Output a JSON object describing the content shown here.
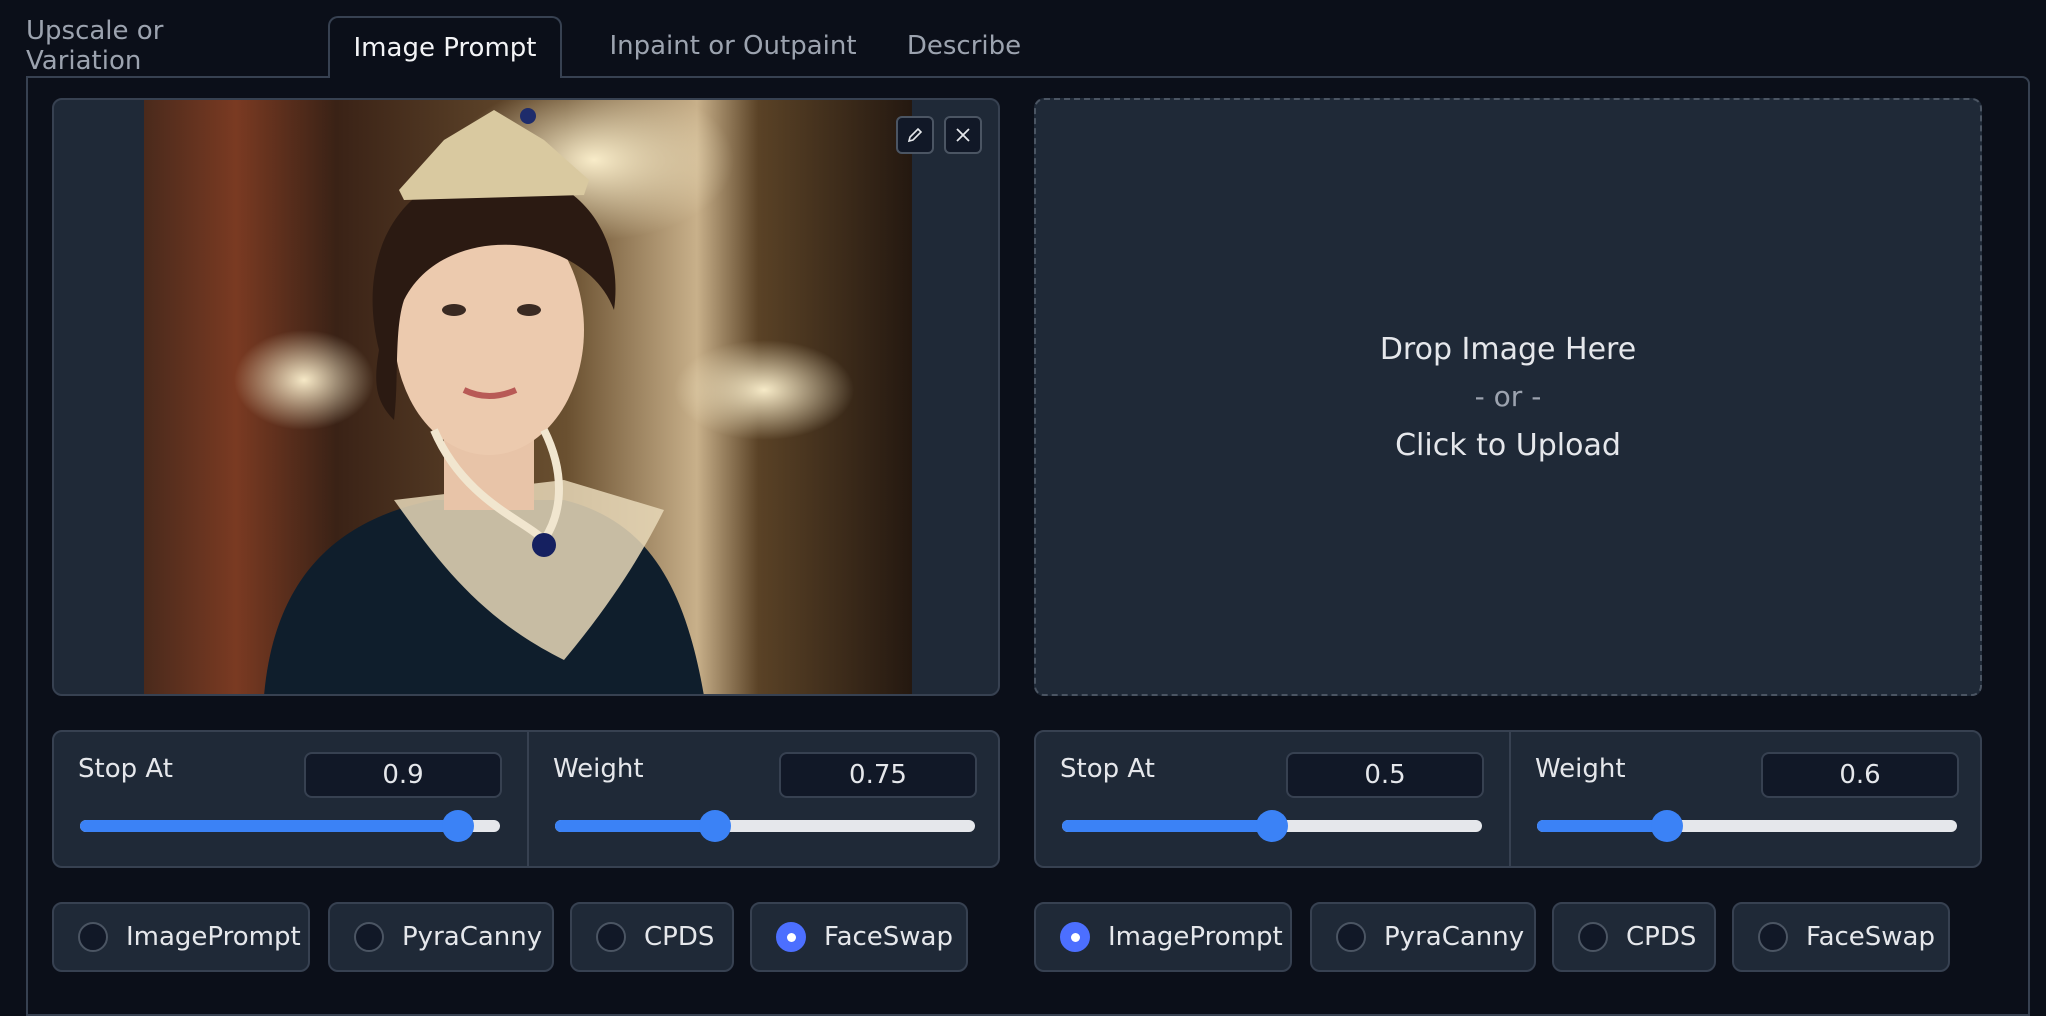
{
  "tabs": [
    {
      "label": "Upscale or Variation",
      "active": false
    },
    {
      "label": "Image Prompt",
      "active": true
    },
    {
      "label": "Inpaint or Outpaint",
      "active": false
    },
    {
      "label": "Describe",
      "active": false
    }
  ],
  "left": {
    "image": {
      "has_image": true,
      "edit_icon": "pencil-icon",
      "close_icon": "close-icon"
    },
    "stop_at": {
      "label": "Stop At",
      "value": "0.9",
      "fraction": 0.9
    },
    "weight": {
      "label": "Weight",
      "value": "0.75",
      "fraction": 0.38
    },
    "types": [
      {
        "label": "ImagePrompt",
        "checked": false
      },
      {
        "label": "PyraCanny",
        "checked": false
      },
      {
        "label": "CPDS",
        "checked": false
      },
      {
        "label": "FaceSwap",
        "checked": true
      }
    ]
  },
  "right": {
    "upload": {
      "line1": "Drop Image Here",
      "line2": "- or -",
      "line3": "Click to Upload"
    },
    "stop_at": {
      "label": "Stop At",
      "value": "0.5",
      "fraction": 0.5
    },
    "weight": {
      "label": "Weight",
      "value": "0.6",
      "fraction": 0.31
    },
    "types": [
      {
        "label": "ImagePrompt",
        "checked": true
      },
      {
        "label": "PyraCanny",
        "checked": false
      },
      {
        "label": "CPDS",
        "checked": false
      },
      {
        "label": "FaceSwap",
        "checked": false
      }
    ]
  },
  "colors": {
    "accent": "#3b82f6",
    "panel": "#1f2937",
    "background": "#0b0f19",
    "border": "#374151"
  }
}
